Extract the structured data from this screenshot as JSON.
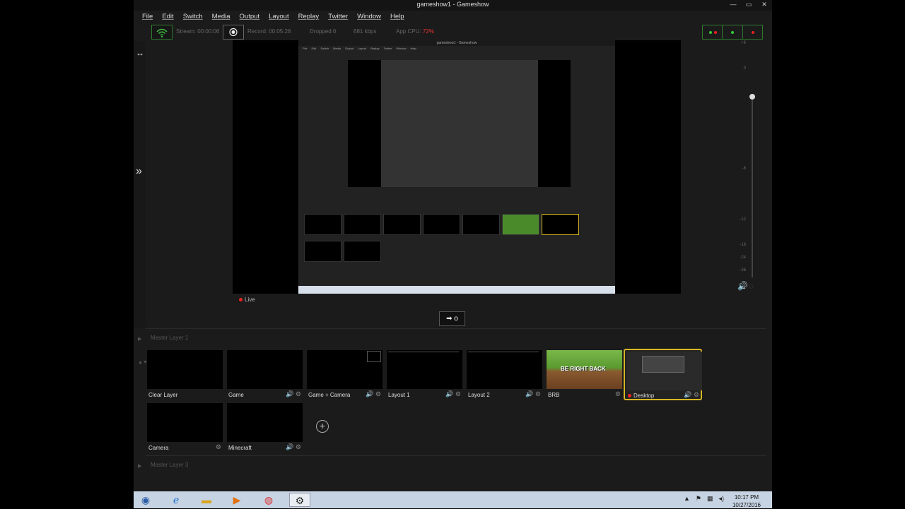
{
  "window": {
    "title": "gameshow1 - Gameshow",
    "controls": {
      "minimize": "—",
      "maximize": "▭",
      "close": "✕"
    }
  },
  "menu": [
    "File",
    "Edit",
    "Switch",
    "Media",
    "Output",
    "Layout",
    "Replay",
    "Twitter",
    "Window",
    "Help"
  ],
  "status": {
    "stream": "Stream: 00:00:06",
    "record": "Record: 00:05:28",
    "dropped": "Dropped 0",
    "bitrate": "681 kbps",
    "cpu_label": "App CPU:",
    "cpu_value": "72%"
  },
  "preview": {
    "live_label": "Live",
    "transition_label": "➡ o",
    "nested_title": "gameshow1 - Gameshow"
  },
  "audio": {
    "ticks": [
      "+6",
      "0",
      "-6",
      "-12",
      "-18",
      "-24",
      "-36"
    ],
    "fader_level_db": 0
  },
  "layers": [
    {
      "name": "Master Layer 1"
    },
    {
      "name": "Master Layer 3"
    }
  ],
  "sources": [
    {
      "label": "Clear Layer",
      "icons": ""
    },
    {
      "label": "Game",
      "icons": "🔊 ⚙"
    },
    {
      "label": "Game + Camera",
      "icons": "🔊 ⚙"
    },
    {
      "label": "Layout 1",
      "icons": "🔊 ⚙"
    },
    {
      "label": "Layout 2",
      "icons": "🔊 ⚙"
    },
    {
      "label": "BRB",
      "icons": "⚙",
      "thumb_text": "BE RIGHT BACK"
    },
    {
      "label": "Desktop",
      "icons": "🔊 ⚙",
      "active": true
    },
    {
      "label": "Camera",
      "icons": "⚙"
    },
    {
      "label": "Minecraft",
      "icons": "🔊 ⚙"
    }
  ],
  "add_label": "+",
  "taskbar": {
    "time": "10:17 PM",
    "date": "10/27/2016"
  },
  "colors": {
    "accent_green": "#2f7a2f",
    "active_border": "#d6b623",
    "live_red": "#e22"
  }
}
